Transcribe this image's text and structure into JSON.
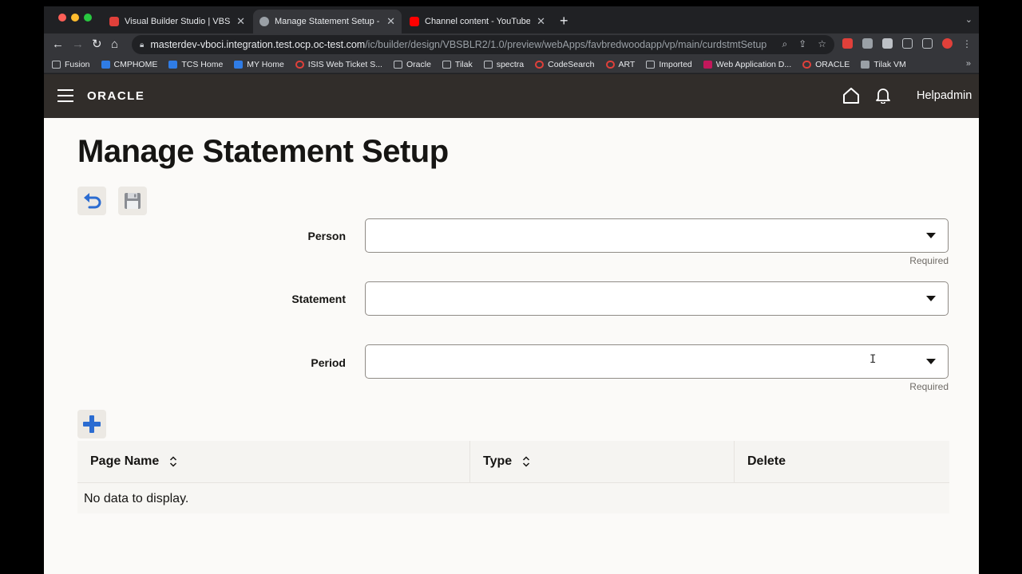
{
  "browser": {
    "tabs": [
      {
        "label": "Visual Builder Studio | VBSBLR",
        "color": "#e0403a"
      },
      {
        "label": "Manage Statement Setup - Ora",
        "color": "#9aa0a6"
      },
      {
        "label": "Channel content - YouTube Stu",
        "color": "#ff0000"
      }
    ],
    "url_host": "masterdev-vboci.integration.test.ocp.oc-test.com",
    "url_path": "/ic/builder/design/VBSBLR2/1.0/preview/webApps/favbredwoodapp/vp/main/curdstmtSetup",
    "bookmarks": [
      {
        "label": "Fusion",
        "icon": "folder-icon",
        "color": "#bdc1c6"
      },
      {
        "label": "CMPHOME",
        "icon": "confluence-icon",
        "color": "#2f7ce5"
      },
      {
        "label": "TCS Home",
        "icon": "confluence-icon",
        "color": "#2f7ce5"
      },
      {
        "label": "MY Home",
        "icon": "confluence-icon",
        "color": "#2f7ce5"
      },
      {
        "label": "ISIS Web Ticket S...",
        "icon": "oracle-icon",
        "color": "#e0403a"
      },
      {
        "label": "Oracle",
        "icon": "folder-icon",
        "color": "#bdc1c6"
      },
      {
        "label": "Tilak",
        "icon": "folder-icon",
        "color": "#bdc1c6"
      },
      {
        "label": "spectra",
        "icon": "folder-icon",
        "color": "#bdc1c6"
      },
      {
        "label": "CodeSearch",
        "icon": "oracle-icon",
        "color": "#e0403a"
      },
      {
        "label": "ART",
        "icon": "oracle-icon",
        "color": "#e0403a"
      },
      {
        "label": "Imported",
        "icon": "folder-icon",
        "color": "#bdc1c6"
      },
      {
        "label": "Web Application D...",
        "icon": "jr-icon",
        "color": "#c2185b"
      },
      {
        "label": "ORACLE",
        "icon": "oracle-icon",
        "color": "#e0403a"
      },
      {
        "label": "Tilak VM",
        "icon": "vm-icon",
        "color": "#9aa0a6"
      }
    ]
  },
  "app": {
    "brand": "ORACLE",
    "user": "Helpadmin"
  },
  "page": {
    "title": "Manage Statement Setup",
    "fields": {
      "person_label": "Person",
      "person_hint": "Required",
      "statement_label": "Statement",
      "period_label": "Period",
      "period_hint": "Required"
    },
    "table": {
      "columns": [
        "Page Name",
        "Type",
        "Delete"
      ],
      "empty_text": "No data to display."
    }
  },
  "colors": {
    "header_bg": "#312d2a",
    "page_bg": "#fbfaf8",
    "accent_blue": "#2b6cd1"
  }
}
